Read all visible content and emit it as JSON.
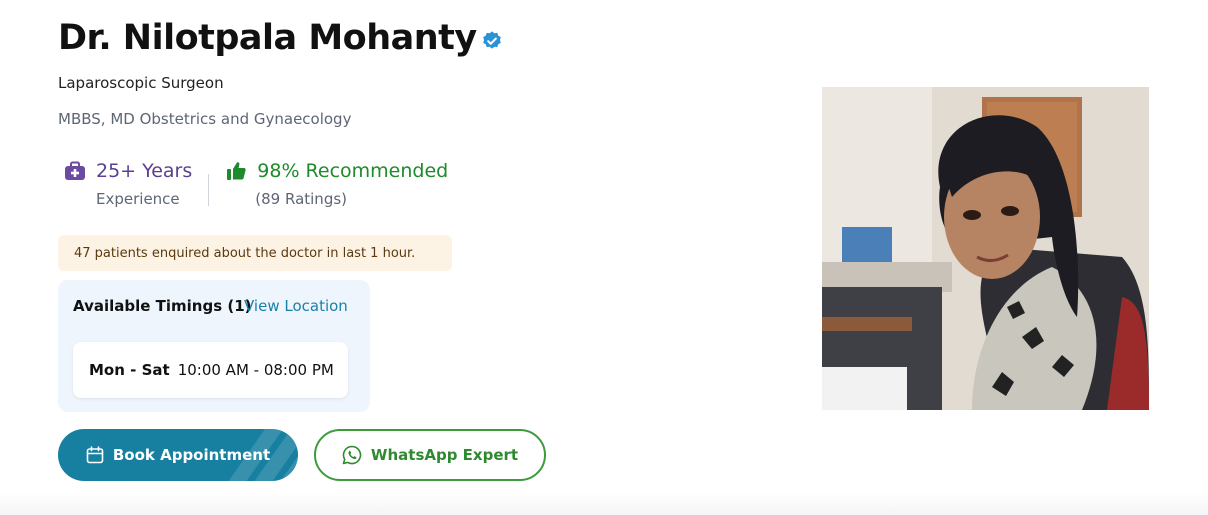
{
  "doctor": {
    "name": "Dr. Nilotpala Mohanty",
    "specialty": "Laparoscopic Surgeon",
    "degree": "MBBS, MD Obstetrics and Gynaecology"
  },
  "stats": {
    "experience_value": "25+ Years",
    "experience_label": "Experience",
    "recommend_value": "98% Recommended",
    "recommend_label": "(89 Ratings)"
  },
  "enquiry_text": "47 patients enquired about the doctor in last 1 hour.",
  "timings": {
    "title": "Available Timings (1)",
    "view_location": "View Location",
    "slots": [
      {
        "days": "Mon - Sat",
        "hours": "10:00 AM - 08:00 PM"
      }
    ]
  },
  "actions": {
    "book": "Book Appointment",
    "whatsapp": "WhatsApp Expert"
  },
  "icons": {
    "verified": "verified-badge-icon",
    "experience": "briefcase-medical-icon",
    "recommend": "thumbs-up-icon",
    "calendar": "calendar-icon",
    "whatsapp": "whatsapp-icon"
  },
  "colors": {
    "primary": "#177fa0",
    "experience": "#5b3f93",
    "recommend": "#1e8a2c",
    "whatsapp": "#3c9b3c",
    "enquiry_bg": "#fdf3e4",
    "timings_bg": "#eef5fc"
  }
}
